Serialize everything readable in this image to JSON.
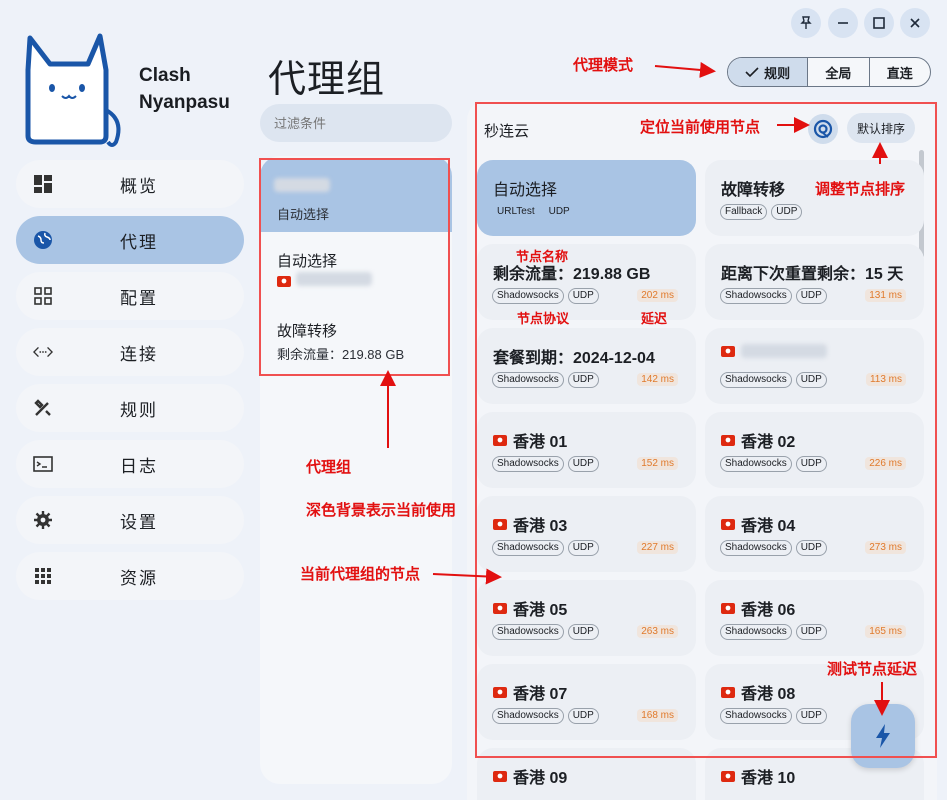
{
  "app": {
    "name_line1": "Clash",
    "name_line2": "Nyanpasu"
  },
  "window_controls": [
    "pin-icon",
    "minimize-icon",
    "maximize-icon",
    "close-icon"
  ],
  "sidebar": {
    "items": [
      {
        "label": "概览",
        "icon": "dashboard-icon"
      },
      {
        "label": "代理",
        "icon": "globe-icon",
        "active": true
      },
      {
        "label": "配置",
        "icon": "grid-icon"
      },
      {
        "label": "连接",
        "icon": "connection-icon"
      },
      {
        "label": "规则",
        "icon": "tools-icon"
      },
      {
        "label": "日志",
        "icon": "terminal-icon"
      },
      {
        "label": "设置",
        "icon": "gear-icon"
      },
      {
        "label": "资源",
        "icon": "apps-icon"
      }
    ]
  },
  "page": {
    "title": "代理组"
  },
  "filter": {
    "placeholder": "过滤条件"
  },
  "groups": [
    {
      "name": "",
      "sub": "自动选择",
      "active": true
    },
    {
      "name": "自动选择",
      "sub": ""
    },
    {
      "name": "故障转移",
      "sub": "剩余流量：219.88 GB"
    }
  ],
  "mode": {
    "options": [
      "规则",
      "全局",
      "直连"
    ],
    "selected": "规则"
  },
  "proxy_panel": {
    "group_title": "秒连云",
    "sort_label": "默认排序",
    "nodes": [
      {
        "name": "自动选择",
        "tags": [
          "URLTest",
          "UDP"
        ],
        "delay": "",
        "selected": true,
        "flag": false
      },
      {
        "name": "故障转移",
        "tags": [
          "Fallback",
          "UDP"
        ],
        "delay": "",
        "flag": false
      },
      {
        "name": "剩余流量：219.88 GB",
        "tags": [
          "Shadowsocks",
          "UDP"
        ],
        "delay": "202 ms",
        "flag": false
      },
      {
        "name": "距离下次重置剩余：15 天",
        "tags": [
          "Shadowsocks",
          "UDP"
        ],
        "delay": "131 ms",
        "flag": false
      },
      {
        "name": "套餐到期：2024-12-04",
        "tags": [
          "Shadowsocks",
          "UDP"
        ],
        "delay": "142 ms",
        "flag": false
      },
      {
        "name": "",
        "tags": [
          "Shadowsocks",
          "UDP"
        ],
        "delay": "113 ms",
        "flag": true
      },
      {
        "name": "香港 01",
        "tags": [
          "Shadowsocks",
          "UDP"
        ],
        "delay": "152 ms",
        "flag": true
      },
      {
        "name": "香港 02",
        "tags": [
          "Shadowsocks",
          "UDP"
        ],
        "delay": "226 ms",
        "flag": true
      },
      {
        "name": "香港 03",
        "tags": [
          "Shadowsocks",
          "UDP"
        ],
        "delay": "227 ms",
        "flag": true
      },
      {
        "name": "香港 04",
        "tags": [
          "Shadowsocks",
          "UDP"
        ],
        "delay": "273 ms",
        "flag": true
      },
      {
        "name": "香港 05",
        "tags": [
          "Shadowsocks",
          "UDP"
        ],
        "delay": "263 ms",
        "flag": true
      },
      {
        "name": "香港 06",
        "tags": [
          "Shadowsocks",
          "UDP"
        ],
        "delay": "165 ms",
        "flag": true
      },
      {
        "name": "香港 07",
        "tags": [
          "Shadowsocks",
          "UDP"
        ],
        "delay": "168 ms",
        "flag": true
      },
      {
        "name": "香港 08",
        "tags": [
          "Shadowsocks",
          "UDP"
        ],
        "delay": "",
        "flag": true
      },
      {
        "name": "香港 09",
        "tags": [],
        "delay": "",
        "flag": true
      },
      {
        "name": "香港 10",
        "tags": [],
        "delay": "",
        "flag": true
      }
    ]
  },
  "annotations": {
    "proxy_mode": "代理模式",
    "locate_node": "定位当前使用节点",
    "adjust_sort": "调整节点排序",
    "node_name": "节点名称",
    "node_protocol": "节点协议",
    "latency": "延迟",
    "proxy_group": "代理组",
    "dark_bg": "深色背景表示当前使用",
    "current_nodes": "当前代理组的节点",
    "test_latency": "测试节点延迟"
  },
  "colors": {
    "accent": "#a9c4e4",
    "annotation": "#e21010",
    "delay": "#e07a2c"
  }
}
